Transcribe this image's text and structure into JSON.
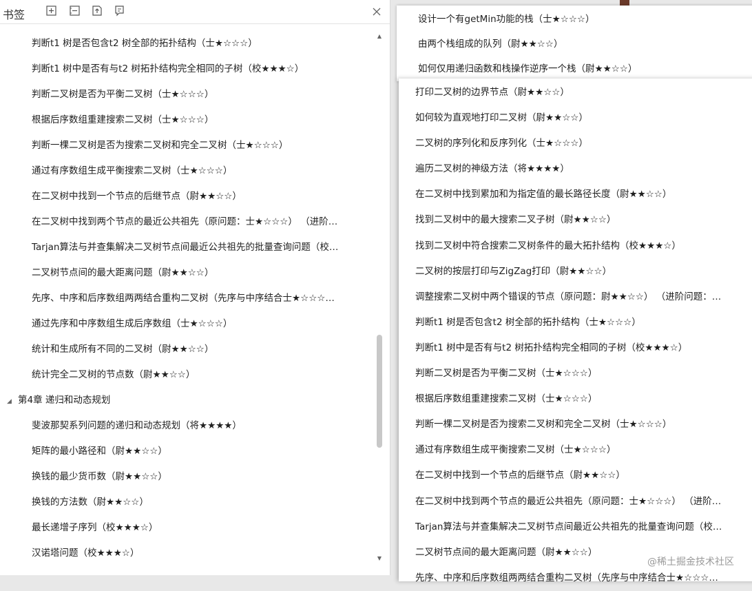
{
  "left": {
    "title": "书签",
    "tools": [
      "add-bookmark-icon",
      "collapse-all-icon",
      "bookmark-up-icon",
      "bookmark-note-icon"
    ],
    "items": [
      {
        "text": "判断t1 树是否包含t2 树全部的拓扑结构（士★☆☆☆）",
        "kind": "child"
      },
      {
        "text": "判断t1 树中是否有与t2 树拓扑结构完全相同的子树（校★★★☆）",
        "kind": "child"
      },
      {
        "text": "判断二叉树是否为平衡二叉树（士★☆☆☆）",
        "kind": "child"
      },
      {
        "text": "根据后序数组重建搜索二叉树（士★☆☆☆）",
        "kind": "child"
      },
      {
        "text": "判断一棵二叉树是否为搜索二叉树和完全二叉树（士★☆☆☆）",
        "kind": "child"
      },
      {
        "text": "通过有序数组生成平衡搜索二叉树（士★☆☆☆）",
        "kind": "child"
      },
      {
        "text": "在二叉树中找到一个节点的后继节点（尉★★☆☆）",
        "kind": "child"
      },
      {
        "text": "在二叉树中找到两个节点的最近公共祖先（原问题：士★☆☆☆） （进阶…",
        "kind": "child"
      },
      {
        "text": "Tarjan算法与并查集解决二叉树节点间最近公共祖先的批量查询问题（校…",
        "kind": "child"
      },
      {
        "text": "二叉树节点间的最大距离问题（尉★★☆☆）",
        "kind": "child"
      },
      {
        "text": "先序、中序和后序数组两两结合重构二叉树（先序与中序结合士★☆☆☆…",
        "kind": "child"
      },
      {
        "text": "通过先序和中序数组生成后序数组（士★☆☆☆）",
        "kind": "child"
      },
      {
        "text": "统计和生成所有不同的二叉树（尉★★☆☆）",
        "kind": "child"
      },
      {
        "text": "统计完全二叉树的节点数（尉★★☆☆）",
        "kind": "child"
      },
      {
        "text": "第4章 递归和动态规划",
        "kind": "chapter"
      },
      {
        "text": "斐波那契系列问题的递归和动态规划（将★★★★）",
        "kind": "child"
      },
      {
        "text": "矩阵的最小路径和（尉★★☆☆）",
        "kind": "child"
      },
      {
        "text": "换钱的最少货币数（尉★★☆☆）",
        "kind": "child"
      },
      {
        "text": "换钱的方法数（尉★★☆☆）",
        "kind": "child"
      },
      {
        "text": "最长递增子序列（校★★★☆）",
        "kind": "child"
      },
      {
        "text": "汉诺塔问题（校★★★☆）",
        "kind": "child"
      }
    ]
  },
  "right_top": {
    "items": [
      "设计一个有getMin功能的栈（士★☆☆☆）",
      "由两个栈组成的队列（尉★★☆☆）",
      "如何仅用递归函数和栈操作逆序一个栈（尉★★☆☆）"
    ]
  },
  "right_main": {
    "items": [
      "打印二叉树的边界节点（尉★★☆☆）",
      "如何较为直观地打印二叉树（尉★★☆☆）",
      "二叉树的序列化和反序列化（士★☆☆☆）",
      "遍历二叉树的神级方法（将★★★★）",
      "在二叉树中找到累加和为指定值的最长路径长度（尉★★☆☆）",
      "找到二叉树中的最大搜索二叉子树（尉★★☆☆）",
      "找到二叉树中符合搜索二叉树条件的最大拓扑结构（校★★★☆）",
      "二叉树的按层打印与ZigZag打印（尉★★☆☆）",
      "调整搜索二叉树中两个错误的节点（原问题：尉★★☆☆） （进阶问题：…",
      "判断t1 树是否包含t2 树全部的拓扑结构（士★☆☆☆）",
      "判断t1 树中是否有与t2 树拓扑结构完全相同的子树（校★★★☆）",
      "判断二叉树是否为平衡二叉树（士★☆☆☆）",
      "根据后序数组重建搜索二叉树（士★☆☆☆）",
      "判断一棵二叉树是否为搜索二叉树和完全二叉树（士★☆☆☆）",
      "通过有序数组生成平衡搜索二叉树（士★☆☆☆）",
      "在二叉树中找到一个节点的后继节点（尉★★☆☆）",
      "在二叉树中找到两个节点的最近公共祖先（原问题：士★☆☆☆） （进阶…",
      "Tarjan算法与并查集解决二叉树节点间最近公共祖先的批量查询问题（校…",
      "二叉树节点间的最大距离问题（尉★★☆☆）",
      "先序、中序和后序数组两两结合重构二叉树（先序与中序结合士★☆☆☆…"
    ]
  },
  "watermark": "@稀土掘金技术社区",
  "colors": {
    "panel": "#ffffff",
    "background": "#e8e8e8",
    "thumb": "#c8c8c8"
  }
}
